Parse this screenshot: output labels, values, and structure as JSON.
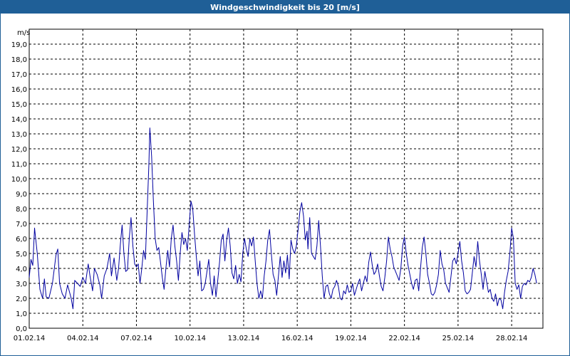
{
  "window": {
    "title": "Windgeschwindigkeit bis 20 [m/s]"
  },
  "chart_data": {
    "type": "line",
    "title": "Windgeschwindigkeit bis 20 [m/s]",
    "ylabel": "m/s",
    "xlabel": "",
    "ylim": [
      0,
      20
    ],
    "xlim": [
      0,
      28.75
    ],
    "grid": true,
    "yticks": [
      "0,0",
      "1,0",
      "2,0",
      "3,0",
      "4,0",
      "5,0",
      "6,0",
      "7,0",
      "8,0",
      "9,0",
      "10,0",
      "11,0",
      "12,0",
      "13,0",
      "14,0",
      "15,0",
      "16,0",
      "17,0",
      "18,0",
      "19,0"
    ],
    "xticks": [
      {
        "label": "01.02.14",
        "day": 0
      },
      {
        "label": "04.02.14",
        "day": 3
      },
      {
        "label": "07.02.14",
        "day": 6
      },
      {
        "label": "10.02.14",
        "day": 9
      },
      {
        "label": "13.02.14",
        "day": 12
      },
      {
        "label": "16.02.14",
        "day": 15
      },
      {
        "label": "19.02.14",
        "day": 18
      },
      {
        "label": "22.02.14",
        "day": 21
      },
      {
        "label": "25.02.14",
        "day": 24
      },
      {
        "label": "28.02.14",
        "day": 27
      }
    ],
    "colors": {
      "line": "#0000a0",
      "grid": "#000000",
      "title_bar": "#1f5f97"
    },
    "series": [
      {
        "values": [
          [
            0.0,
            3.4
          ],
          [
            0.1,
            4.6
          ],
          [
            0.2,
            4.2
          ],
          [
            0.3,
            6.7
          ],
          [
            0.45,
            5.0
          ],
          [
            0.6,
            2.6
          ],
          [
            0.75,
            2.0
          ],
          [
            0.85,
            3.3
          ],
          [
            0.95,
            2.1
          ],
          [
            1.1,
            2.0
          ],
          [
            1.3,
            3.0
          ],
          [
            1.5,
            4.9
          ],
          [
            1.6,
            5.3
          ],
          [
            1.7,
            3.0
          ],
          [
            1.85,
            2.3
          ],
          [
            2.0,
            2.0
          ],
          [
            2.15,
            2.9
          ],
          [
            2.35,
            2.0
          ],
          [
            2.45,
            1.3
          ],
          [
            2.55,
            3.2
          ],
          [
            2.7,
            3.0
          ],
          [
            2.85,
            2.8
          ],
          [
            3.0,
            3.4
          ],
          [
            3.15,
            3.0
          ],
          [
            3.3,
            4.3
          ],
          [
            3.4,
            3.5
          ],
          [
            3.55,
            2.5
          ],
          [
            3.65,
            4.0
          ],
          [
            3.8,
            3.6
          ],
          [
            3.95,
            2.9
          ],
          [
            4.05,
            2.0
          ],
          [
            4.2,
            3.5
          ],
          [
            4.35,
            4.0
          ],
          [
            4.5,
            5.0
          ],
          [
            4.6,
            3.5
          ],
          [
            4.75,
            4.7
          ],
          [
            4.9,
            3.2
          ],
          [
            5.0,
            4.0
          ],
          [
            5.1,
            5.6
          ],
          [
            5.2,
            6.9
          ],
          [
            5.3,
            5.0
          ],
          [
            5.4,
            3.8
          ],
          [
            5.5,
            3.9
          ],
          [
            5.6,
            6.0
          ],
          [
            5.7,
            7.4
          ],
          [
            5.8,
            5.5
          ],
          [
            5.9,
            4.3
          ],
          [
            6.0,
            4.1
          ],
          [
            6.1,
            4.3
          ],
          [
            6.2,
            3.0
          ],
          [
            6.3,
            4.0
          ],
          [
            6.4,
            5.2
          ],
          [
            6.5,
            4.6
          ],
          [
            6.6,
            7.8
          ],
          [
            6.7,
            11.0
          ],
          [
            6.75,
            13.4
          ],
          [
            6.85,
            11.5
          ],
          [
            6.95,
            8.5
          ],
          [
            7.05,
            6.0
          ],
          [
            7.15,
            5.2
          ],
          [
            7.25,
            5.4
          ],
          [
            7.35,
            4.4
          ],
          [
            7.45,
            3.4
          ],
          [
            7.55,
            2.6
          ],
          [
            7.65,
            4.0
          ],
          [
            7.75,
            5.2
          ],
          [
            7.85,
            4.1
          ],
          [
            7.95,
            6.0
          ],
          [
            8.05,
            6.9
          ],
          [
            8.15,
            5.5
          ],
          [
            8.25,
            4.5
          ],
          [
            8.35,
            3.2
          ],
          [
            8.45,
            5.0
          ],
          [
            8.55,
            6.4
          ],
          [
            8.65,
            5.6
          ],
          [
            8.75,
            6.0
          ],
          [
            8.85,
            5.2
          ],
          [
            8.95,
            6.9
          ],
          [
            9.05,
            8.5
          ],
          [
            9.15,
            8.0
          ],
          [
            9.25,
            6.3
          ],
          [
            9.35,
            4.8
          ],
          [
            9.45,
            3.5
          ],
          [
            9.55,
            4.5
          ],
          [
            9.65,
            2.5
          ],
          [
            9.75,
            2.6
          ],
          [
            9.85,
            3.0
          ],
          [
            9.95,
            3.8
          ],
          [
            10.05,
            4.6
          ],
          [
            10.15,
            3.0
          ],
          [
            10.25,
            2.2
          ],
          [
            10.35,
            3.5
          ],
          [
            10.45,
            2.1
          ],
          [
            10.55,
            3.2
          ],
          [
            10.65,
            4.4
          ],
          [
            10.75,
            5.9
          ],
          [
            10.85,
            6.3
          ],
          [
            10.95,
            4.5
          ],
          [
            11.05,
            5.9
          ],
          [
            11.15,
            6.7
          ],
          [
            11.25,
            5.5
          ],
          [
            11.35,
            3.7
          ],
          [
            11.45,
            3.3
          ],
          [
            11.55,
            4.2
          ],
          [
            11.65,
            3.0
          ],
          [
            11.75,
            3.6
          ],
          [
            11.85,
            3.1
          ],
          [
            11.95,
            5.0
          ],
          [
            12.05,
            6.0
          ],
          [
            12.15,
            5.3
          ],
          [
            12.25,
            4.8
          ],
          [
            12.35,
            6.0
          ],
          [
            12.45,
            5.5
          ],
          [
            12.55,
            6.1
          ],
          [
            12.65,
            4.5
          ],
          [
            12.75,
            3.0
          ],
          [
            12.85,
            2.0
          ],
          [
            12.95,
            2.5
          ],
          [
            13.05,
            2.0
          ],
          [
            13.15,
            3.5
          ],
          [
            13.25,
            4.5
          ],
          [
            13.35,
            5.9
          ],
          [
            13.45,
            6.6
          ],
          [
            13.55,
            5.0
          ],
          [
            13.65,
            3.6
          ],
          [
            13.75,
            3.2
          ],
          [
            13.85,
            2.2
          ],
          [
            13.95,
            3.5
          ],
          [
            14.05,
            4.8
          ],
          [
            14.15,
            3.4
          ],
          [
            14.25,
            4.5
          ],
          [
            14.35,
            3.7
          ],
          [
            14.45,
            4.9
          ],
          [
            14.55,
            3.3
          ],
          [
            14.65,
            5.9
          ],
          [
            14.75,
            5.3
          ],
          [
            14.85,
            5.0
          ],
          [
            14.95,
            5.5
          ],
          [
            15.05,
            6.6
          ],
          [
            15.15,
            7.8
          ],
          [
            15.25,
            8.4
          ],
          [
            15.35,
            7.5
          ],
          [
            15.45,
            5.9
          ],
          [
            15.55,
            6.5
          ],
          [
            15.6,
            5.3
          ],
          [
            15.7,
            7.4
          ],
          [
            15.8,
            5.0
          ],
          [
            15.9,
            4.8
          ],
          [
            16.0,
            4.6
          ],
          [
            16.1,
            5.5
          ],
          [
            16.2,
            7.2
          ],
          [
            16.3,
            5.5
          ],
          [
            16.4,
            3.5
          ],
          [
            16.5,
            2.0
          ],
          [
            16.6,
            2.8
          ],
          [
            16.7,
            2.9
          ],
          [
            16.8,
            2.3
          ],
          [
            16.9,
            2.0
          ],
          [
            17.0,
            2.6
          ],
          [
            17.1,
            2.8
          ],
          [
            17.2,
            3.2
          ],
          [
            17.3,
            2.8
          ],
          [
            17.4,
            2.0
          ],
          [
            17.5,
            1.9
          ],
          [
            17.6,
            2.5
          ],
          [
            17.7,
            2.3
          ],
          [
            17.8,
            2.9
          ],
          [
            17.9,
            2.4
          ],
          [
            18.0,
            2.5
          ],
          [
            18.1,
            3.0
          ],
          [
            18.2,
            2.2
          ],
          [
            18.3,
            2.6
          ],
          [
            18.4,
            3.0
          ],
          [
            18.5,
            3.3
          ],
          [
            18.6,
            2.5
          ],
          [
            18.7,
            3.0
          ],
          [
            18.8,
            3.5
          ],
          [
            18.9,
            3.1
          ],
          [
            19.0,
            4.4
          ],
          [
            19.1,
            5.1
          ],
          [
            19.2,
            4.2
          ],
          [
            19.3,
            3.6
          ],
          [
            19.4,
            3.8
          ],
          [
            19.5,
            4.3
          ],
          [
            19.6,
            3.5
          ],
          [
            19.7,
            2.8
          ],
          [
            19.8,
            2.5
          ],
          [
            19.9,
            3.4
          ],
          [
            20.0,
            4.5
          ],
          [
            20.1,
            6.1
          ],
          [
            20.2,
            5.3
          ],
          [
            20.3,
            4.8
          ],
          [
            20.4,
            4.1
          ],
          [
            20.5,
            3.8
          ],
          [
            20.6,
            3.5
          ],
          [
            20.7,
            3.2
          ],
          [
            20.8,
            4.0
          ],
          [
            20.9,
            5.5
          ],
          [
            21.0,
            6.1
          ],
          [
            21.1,
            5.0
          ],
          [
            21.2,
            4.2
          ],
          [
            21.3,
            3.6
          ],
          [
            21.4,
            3.0
          ],
          [
            21.5,
            2.6
          ],
          [
            21.6,
            3.2
          ],
          [
            21.7,
            3.3
          ],
          [
            21.8,
            2.5
          ],
          [
            21.9,
            4.0
          ],
          [
            22.0,
            5.4
          ],
          [
            22.1,
            6.1
          ],
          [
            22.2,
            5.0
          ],
          [
            22.3,
            3.6
          ],
          [
            22.4,
            3.0
          ],
          [
            22.5,
            2.3
          ],
          [
            22.6,
            2.2
          ],
          [
            22.7,
            2.4
          ],
          [
            22.8,
            2.9
          ],
          [
            22.9,
            3.6
          ],
          [
            23.0,
            5.2
          ],
          [
            23.1,
            4.3
          ],
          [
            23.2,
            3.9
          ],
          [
            23.3,
            3.0
          ],
          [
            23.4,
            2.7
          ],
          [
            23.5,
            2.4
          ],
          [
            23.6,
            3.4
          ],
          [
            23.7,
            4.5
          ],
          [
            23.8,
            4.7
          ],
          [
            23.9,
            4.3
          ],
          [
            24.0,
            5.0
          ],
          [
            24.1,
            5.8
          ],
          [
            24.2,
            4.5
          ],
          [
            24.3,
            3.7
          ],
          [
            24.4,
            2.5
          ],
          [
            24.5,
            2.3
          ],
          [
            24.6,
            2.4
          ],
          [
            24.7,
            2.6
          ],
          [
            24.8,
            3.7
          ],
          [
            24.9,
            4.8
          ],
          [
            25.0,
            4.1
          ],
          [
            25.1,
            5.8
          ],
          [
            25.2,
            4.5
          ],
          [
            25.3,
            3.6
          ],
          [
            25.4,
            2.6
          ],
          [
            25.5,
            3.8
          ],
          [
            25.6,
            3.1
          ],
          [
            25.7,
            2.4
          ],
          [
            25.8,
            2.6
          ],
          [
            25.9,
            2.0
          ],
          [
            26.0,
            1.8
          ],
          [
            26.1,
            2.3
          ],
          [
            26.2,
            1.5
          ],
          [
            26.3,
            2.0
          ],
          [
            26.4,
            1.9
          ],
          [
            26.5,
            1.3
          ],
          [
            26.6,
            2.4
          ],
          [
            26.7,
            3.2
          ],
          [
            26.8,
            3.8
          ],
          [
            26.9,
            5.0
          ],
          [
            27.0,
            6.7
          ],
          [
            27.1,
            6.0
          ],
          [
            27.2,
            3.0
          ],
          [
            27.3,
            2.6
          ],
          [
            27.4,
            2.9
          ],
          [
            27.5,
            2.0
          ],
          [
            27.6,
            2.8
          ],
          [
            27.7,
            3.0
          ],
          [
            27.8,
            2.9
          ],
          [
            27.9,
            3.2
          ],
          [
            28.0,
            3.1
          ],
          [
            28.1,
            3.4
          ],
          [
            28.2,
            4.0
          ],
          [
            28.3,
            3.6
          ],
          [
            28.4,
            3.0
          ]
        ]
      }
    ]
  }
}
